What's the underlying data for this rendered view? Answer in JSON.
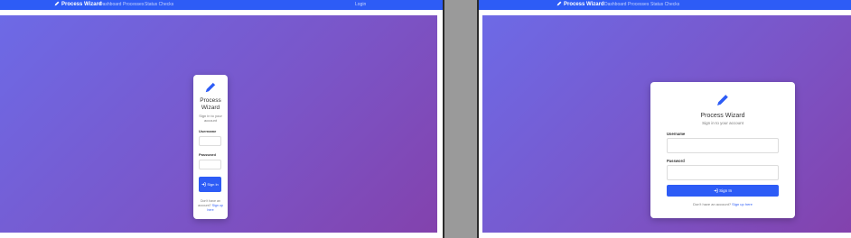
{
  "nav": {
    "brand": "Process Wizard",
    "links": [
      "Dashboard",
      "Processes",
      "Status Checks"
    ],
    "login": "Login"
  },
  "card": {
    "title": "Process Wizard",
    "subtitle": "Sign in to your account",
    "username_label": "Username",
    "password_label": "Password",
    "signin_label": "Sign In",
    "footer_text": "Don't have an account?",
    "footer_link": "Sign up here"
  },
  "icons": {
    "brand": "pencil-icon",
    "logo": "pencil-icon",
    "signin": "sign-in-icon"
  },
  "colors": {
    "nav": "#2d5cf6",
    "accent": "#2d5cf6",
    "gradient_start": "#6d6ae6",
    "gradient_end": "#8342ad"
  }
}
